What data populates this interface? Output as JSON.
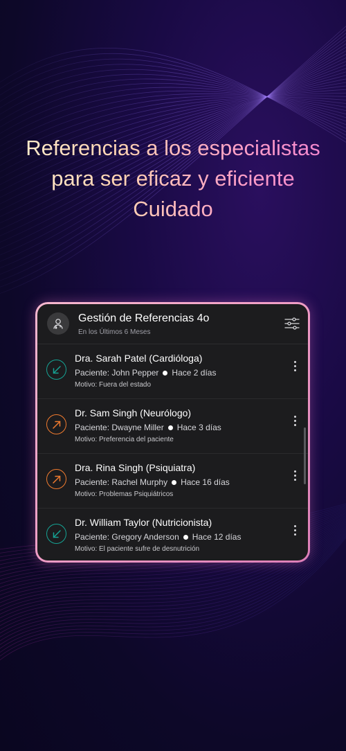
{
  "headline": {
    "line1": "Referencias a los especialistas",
    "line2": "para ser eficaz y eficiente",
    "line3": "Cuidado"
  },
  "card": {
    "title": "Gestión de Referencias 4o",
    "subtitle": "En los Últimos 6 Meses",
    "header_icons": {
      "avatar": "doctor-avatar-icon",
      "filter": "filter-sliders-icon"
    }
  },
  "referrals": [
    {
      "doctor": "Dra. Sarah Patel (Cardióloga)",
      "patient": "Paciente: John Pepper",
      "time": "Hace 2 días",
      "reason": "Motivo: Fuera del estado",
      "direction": "incoming",
      "color": "#16a394"
    },
    {
      "doctor": "Dr. Sam Singh (Neurólogo)",
      "patient": "Paciente: Dwayne Miller",
      "time": "Hace 3 días",
      "reason": "Motivo: Preferencia del paciente",
      "direction": "outgoing",
      "color": "#f07b2f"
    },
    {
      "doctor": "Dra. Rina Singh (Psiquiatra)",
      "patient": "Paciente: Rachel Murphy",
      "time": "Hace 16 días",
      "reason": "Motivo: Problemas Psiquiátricos",
      "direction": "outgoing",
      "color": "#f07b2f"
    },
    {
      "doctor": "Dr. William Taylor (Nutricionista)",
      "patient": "Paciente: Gregory Anderson",
      "time": "Hace 12 días",
      "reason": "Motivo: El paciente sufre de desnutrición",
      "direction": "incoming",
      "color": "#16a394"
    }
  ],
  "colors": {
    "card_bg": "#1c1c1e",
    "frame_gradient_start": "#f7b8cf",
    "frame_gradient_end": "#dd7fb8",
    "incoming": "#16a394",
    "outgoing": "#f07b2f"
  }
}
